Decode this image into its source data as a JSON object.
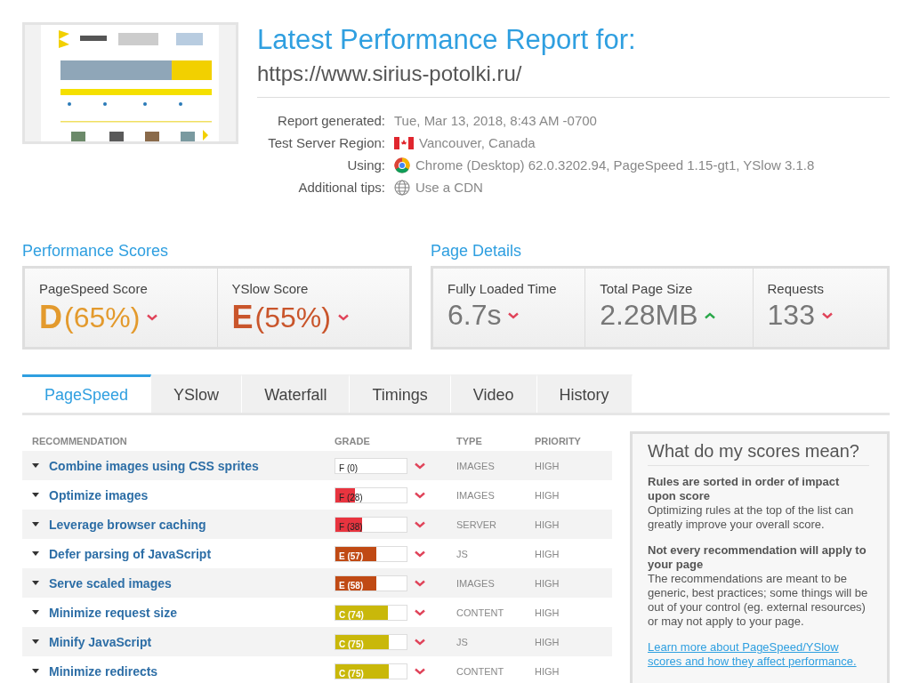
{
  "title": "Latest Performance Report for:",
  "url": "https://www.sirius-potolki.ru/",
  "details": [
    {
      "label": "Report generated:",
      "value": "Tue, Mar 13, 2018, 8:43 AM -0700"
    },
    {
      "label": "Test Server Region:",
      "value": "Vancouver, Canada"
    },
    {
      "label": "Using:",
      "value": "Chrome (Desktop) 62.0.3202.94, PageSpeed 1.15-gt1, YSlow 3.1.8"
    },
    {
      "label": "Additional tips:",
      "value": "Use a CDN"
    }
  ],
  "performance": {
    "heading": "Performance Scores",
    "scores": [
      {
        "label": "PageSpeed Score",
        "grade": "D",
        "value": "(65%)",
        "color": "#e39a2d",
        "rising": false
      },
      {
        "label": "YSlow Score",
        "grade": "E",
        "value": "(55%)",
        "color": "#c9552b",
        "rising": false
      }
    ]
  },
  "page_details": {
    "heading": "Page Details",
    "metrics": [
      {
        "label": "Fully Loaded Time",
        "value": "6.7s",
        "rising": false
      },
      {
        "label": "Total Page Size",
        "value": "2.28MB",
        "rising": true
      },
      {
        "label": "Requests",
        "value": "133",
        "rising": false
      }
    ]
  },
  "tabs": [
    {
      "label": "PageSpeed",
      "selected": true
    },
    {
      "label": "YSlow",
      "selected": false
    },
    {
      "label": "Waterfall",
      "selected": false
    },
    {
      "label": "Timings",
      "selected": false
    },
    {
      "label": "Video",
      "selected": false
    },
    {
      "label": "History",
      "selected": false
    }
  ],
  "table": {
    "columns": [
      "RECOMMENDATION",
      "GRADE",
      "TYPE",
      "PRIORITY"
    ],
    "rows": [
      {
        "name": "Combine images using CSS sprites",
        "grade": "F (0)",
        "type": "IMAGES",
        "priority": "HIGH",
        "rising": false
      },
      {
        "name": "Optimize images",
        "grade": "F (28)",
        "level": 0.28,
        "color": "#e8343f",
        "type": "IMAGES",
        "priority": "HIGH",
        "rising": false
      },
      {
        "name": "Leverage browser caching",
        "grade": "F (38)",
        "level": 0.38,
        "color": "#e8343f",
        "type": "SERVER",
        "priority": "HIGH",
        "rising": false
      },
      {
        "name": "Defer parsing of JavaScript",
        "grade": "E (57)",
        "level": 0.57,
        "color": "#c04a14",
        "type": "JS",
        "priority": "HIGH",
        "rising": false
      },
      {
        "name": "Serve scaled images",
        "grade": "E (58)",
        "level": 0.58,
        "color": "#c04a14",
        "type": "IMAGES",
        "priority": "HIGH",
        "rising": false
      },
      {
        "name": "Minimize request size",
        "grade": "C (74)",
        "level": 0.74,
        "color": "#c9b80a",
        "type": "CONTENT",
        "priority": "HIGH",
        "rising": false
      },
      {
        "name": "Minify JavaScript",
        "grade": "C (75)",
        "level": 0.75,
        "color": "#c9b80a",
        "type": "JS",
        "priority": "HIGH",
        "rising": false
      },
      {
        "name": "Minimize redirects",
        "grade": "C (75)",
        "level": 0.75,
        "color": "#c9b80a",
        "type": "CONTENT",
        "priority": "HIGH",
        "rising": false
      }
    ]
  },
  "sidebar": {
    "title": "What do my scores mean?",
    "sections": [
      {
        "heading": "Rules are sorted in order of impact upon score",
        "text": "Optimizing rules at the top of the list can greatly improve your overall score."
      },
      {
        "heading": "Not every recommendation will apply to your page",
        "text": "The recommendations are meant to be generic, best practices; some things will be out of your control (eg. external resources) or may not apply to your page."
      }
    ],
    "link": "Learn more about PageSpeed/YSlow scores and how they affect performance."
  }
}
